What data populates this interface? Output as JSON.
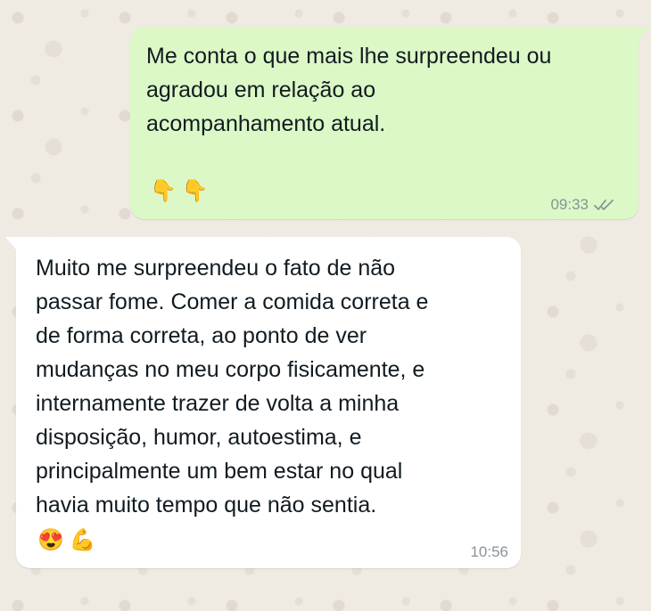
{
  "outgoing_message": {
    "text": "Me conta o que mais lhe surpreendeu ou\nagradou em relação ao\nacompanhamento atual.",
    "emojis": "👇👇",
    "time": "09:33",
    "status_icon": "double-check-icon"
  },
  "incoming_message": {
    "text": "Muito me surpreendeu o fato de não\npassar fome. Comer a comida correta e\nde forma correta, ao ponto de ver\nmudanças no meu corpo fisicamente, e\ninternamente trazer de volta a minha\ndisposição, humor, autoestima, e\nprincipalmente um bem estar no qual\nhavia muito tempo que não sentia.",
    "emojis": "😍💪",
    "time": "10:56"
  },
  "colors": {
    "outgoing_bubble": "#dcf8c6",
    "incoming_bubble": "#ffffff",
    "wallpaper": "#efeae2",
    "timestamp": "#8a9297"
  }
}
